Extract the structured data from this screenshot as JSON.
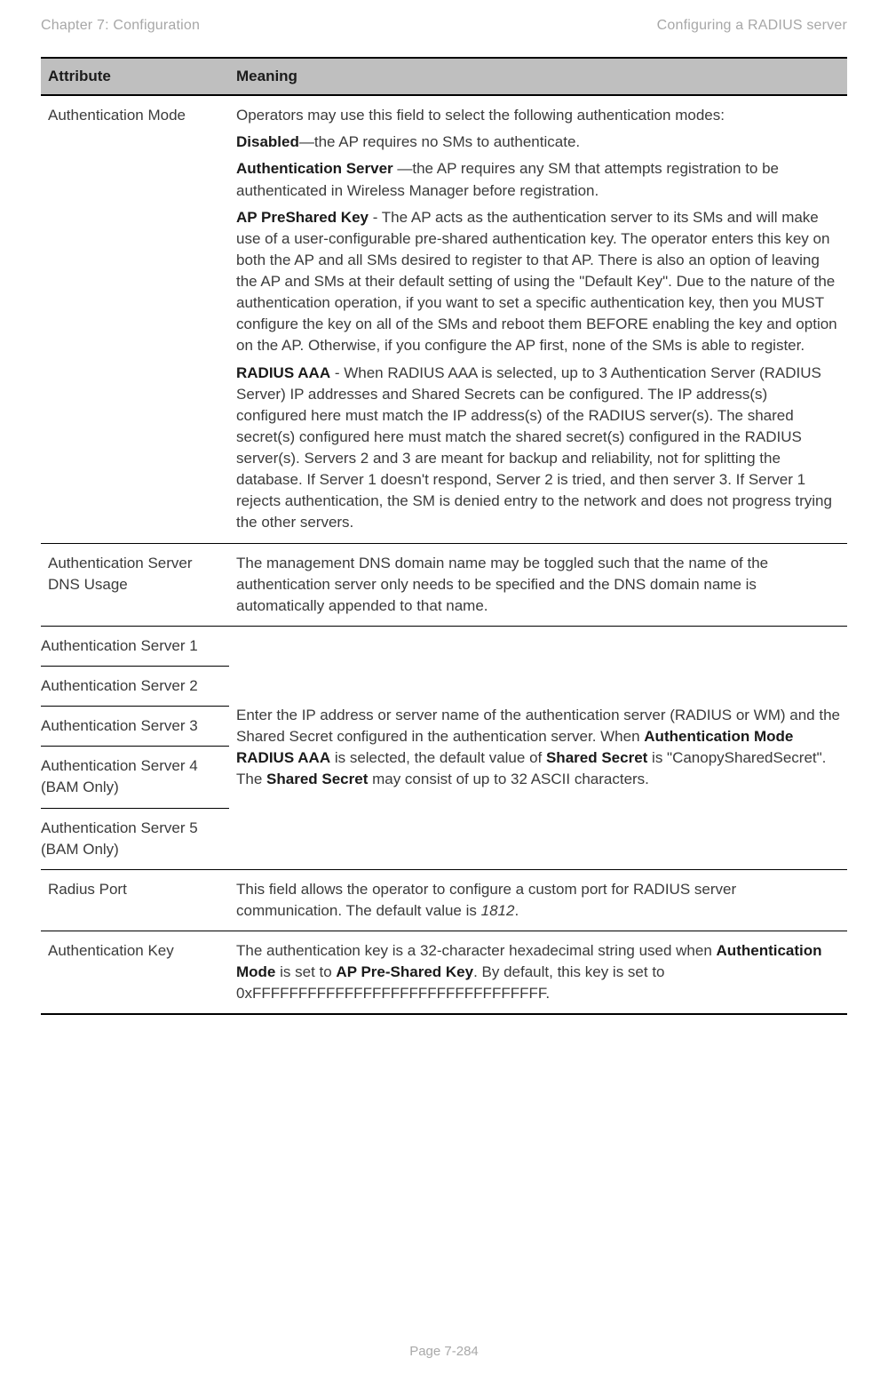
{
  "header": {
    "left": "Chapter 7:  Configuration",
    "right": "Configuring a RADIUS server"
  },
  "footer": {
    "page": "Page 7-284"
  },
  "columns": {
    "attribute": "Attribute",
    "meaning": "Meaning"
  },
  "rows": {
    "auth_mode": {
      "label": "Authentication Mode",
      "intro": "Operators may use this field to select the following authentication modes:",
      "disabled_b": "Disabled",
      "disabled_t": "—the AP requires no SMs to authenticate.",
      "authserver_b": "Authentication Server",
      "authserver_t": " —the AP requires any SM that attempts registration to be authenticated in Wireless Manager before registration.",
      "preshared_b": "AP PreShared Key",
      "preshared_t": " - The AP acts as the authentication server to its SMs and will make use of a user-configurable pre-shared authentication key. The operator enters this key on both the AP and all SMs desired to register to that AP. There is also an option of leaving the AP and SMs at their default setting of using the \"Default Key\". Due to the nature of the authentication operation, if you want to set a specific authentication key, then you MUST configure the key on all of the SMs and reboot them BEFORE enabling the key and option on the AP. Otherwise, if you configure the AP first, none of the SMs is able to register.",
      "radius_b": "RADIUS AAA",
      "radius_t": " - When RADIUS AAA is selected, up to 3 Authentication Server (RADIUS Server) IP addresses and Shared Secrets can be configured. The IP address(s) configured here must match the IP address(s) of the RADIUS server(s). The shared secret(s) configured here must match the shared secret(s) configured in the RADIUS server(s). Servers 2 and 3 are meant for backup and reliability, not for splitting the database. If Server 1 doesn't respond, Server 2 is tried, and then server 3. If Server 1 rejects authentication, the SM is denied entry to the network and does not progress trying the other servers."
    },
    "dns_usage": {
      "label": "Authentication Server DNS Usage",
      "text": "The management DNS domain name may be toggled such that the name of the authentication server only needs to be specified and the DNS domain name is automatically appended to that name."
    },
    "servers": {
      "s1": "Authentication Server 1",
      "s2": "Authentication Server 2",
      "s3": "Authentication Server 3",
      "s4": "Authentication Server 4 (BAM Only)",
      "s5": "Authentication Server 5 (BAM Only)",
      "meaning_pre": "Enter the IP address or server name of the authentication server (RADIUS or WM) and the Shared Secret configured in the authentication server. When ",
      "meaning_b1": "Authentication Mode RADIUS AAA",
      "meaning_mid1": " is selected, the default value of ",
      "meaning_b2": "Shared Secret",
      "meaning_mid2": " is \"CanopySharedSecret\". The ",
      "meaning_b3": "Shared Secret",
      "meaning_post": " may consist of up to 32 ASCII characters."
    },
    "radius_port": {
      "label": "Radius Port",
      "pre": "This field allows the operator to configure a custom port for RADIUS server communication. The default value is ",
      "val": "1812",
      "post": "."
    },
    "auth_key": {
      "label": "Authentication Key",
      "pre": "The authentication key is a 32-character hexadecimal string used when ",
      "b1": "Authentication Mode",
      "mid1": " is set to ",
      "b2": "AP Pre-Shared Key",
      "post": ". By default, this key is set to 0xFFFFFFFFFFFFFFFFFFFFFFFFFFFFFFFF."
    }
  }
}
